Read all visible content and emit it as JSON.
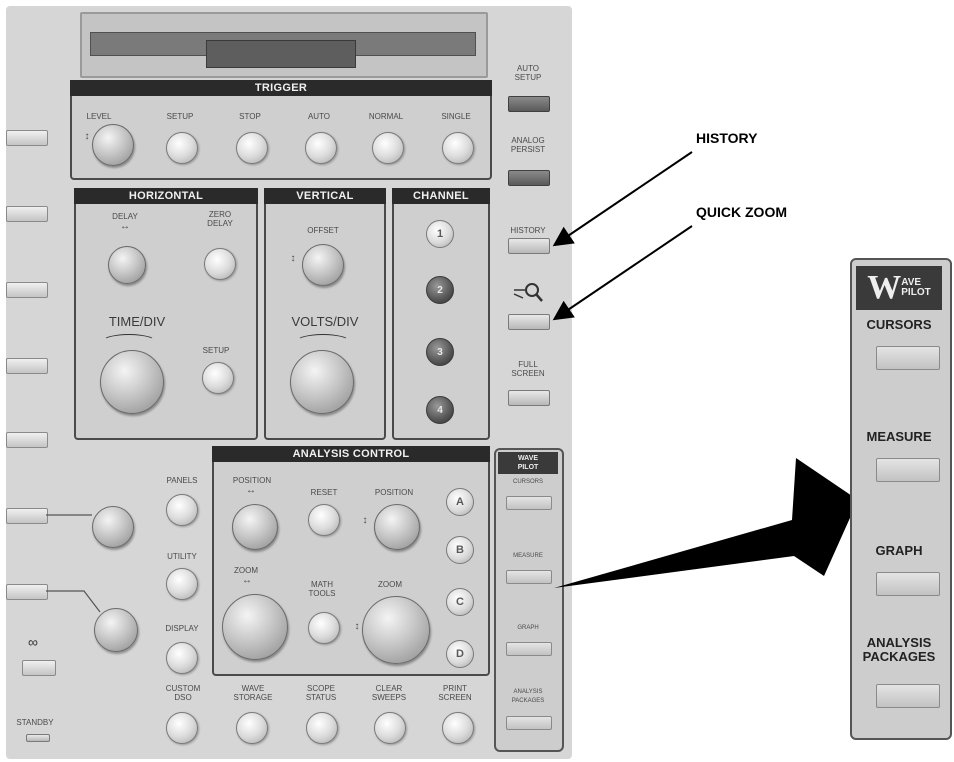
{
  "trigger": {
    "title": "TRIGGER",
    "level": "LEVEL",
    "setup": "SETUP",
    "stop": "STOP",
    "auto": "AUTO",
    "normal": "NORMAL",
    "single": "SINGLE"
  },
  "right_column": {
    "auto_setup": "AUTO\nSETUP",
    "analog_persist": "ANALOG\nPERSIST",
    "history": "HISTORY",
    "full_screen": "FULL\nSCREEN"
  },
  "horizontal": {
    "title": "HORIZONTAL",
    "delay": "DELAY",
    "zero_delay": "ZERO\nDELAY",
    "time_div": "TIME/DIV",
    "setup": "SETUP"
  },
  "vertical": {
    "title": "VERTICAL",
    "offset": "OFFSET",
    "volts_div": "VOLTS/DIV"
  },
  "channel": {
    "title": "CHANNEL",
    "buttons": [
      "1",
      "2",
      "3",
      "4"
    ]
  },
  "analysis": {
    "title": "ANALYSIS CONTROL",
    "position_left": "POSITION",
    "reset": "RESET",
    "position_right": "POSITION",
    "zoom_left": "ZOOM",
    "math_tools": "MATH\nTOOLS",
    "zoom_right": "ZOOM",
    "letters": [
      "A",
      "B",
      "C",
      "D"
    ]
  },
  "left_misc": {
    "panels": "PANELS",
    "utility": "UTILITY",
    "display": "DISPLAY",
    "standby": "STANDBY"
  },
  "bottom_row": {
    "custom_dso": "CUSTOM\nDSO",
    "wave_storage": "WAVE\nSTORAGE",
    "scope_status": "SCOPE\nSTATUS",
    "clear_sweeps": "CLEAR\nSWEEPS",
    "print_screen": "PRINT\nSCREEN"
  },
  "wavepilot_small": {
    "logo": "WAVE\nPILOT",
    "cursors": "CURSORS",
    "measure": "MEASURE",
    "graph": "GRAPH",
    "analysis_packages": "ANALYSIS\nPACKAGES"
  },
  "callouts": {
    "history": "HISTORY",
    "quick_zoom": "QUICK ZOOM"
  },
  "wavepilot_large": {
    "logo_w": "W",
    "logo_rest": "AVE\nPILOT",
    "cursors": "CURSORS",
    "measure": "MEASURE",
    "graph": "GRAPH",
    "analysis_packages": "ANALYSIS\nPACKAGES"
  }
}
